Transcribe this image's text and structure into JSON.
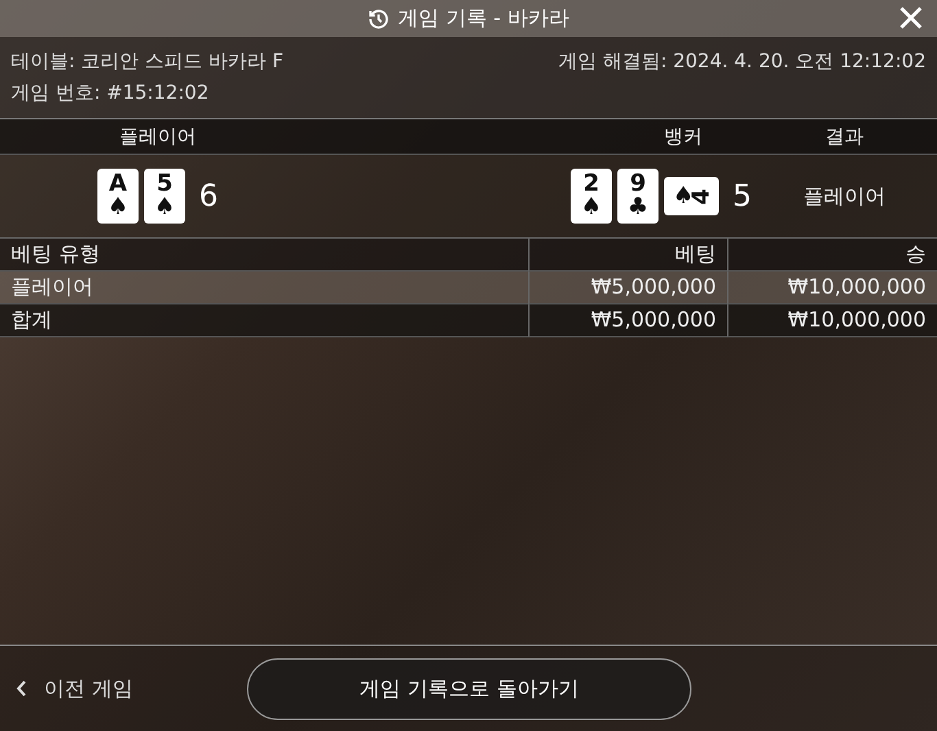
{
  "window": {
    "title": "게임 기록 - 바카라"
  },
  "info": {
    "table": "테이블: 코리안 스피드 바카라 F",
    "game_number": "게임 번호: #15:12:02",
    "resolved": "게임 해결됨: 2024. 4. 20. 오전 12:12:02"
  },
  "result_table": {
    "columns": [
      "플레이어",
      "뱅커",
      "결과"
    ],
    "player": {
      "cards": [
        {
          "rank": "A",
          "suit": "♠",
          "rotated": false
        },
        {
          "rank": "5",
          "suit": "♠",
          "rotated": false
        }
      ],
      "score": "6"
    },
    "banker": {
      "cards": [
        {
          "rank": "2",
          "suit": "♠",
          "rotated": false
        },
        {
          "rank": "9",
          "suit": "♣",
          "rotated": false
        },
        {
          "rank": "4",
          "suit": "♠",
          "rotated": true
        }
      ],
      "score": "5"
    },
    "result": "플레이어"
  },
  "bet_table": {
    "columns": [
      "베팅 유형",
      "베팅",
      "승"
    ],
    "rows": [
      {
        "kind": "bet",
        "cells": [
          "플레이어",
          "₩5,000,000",
          "₩10,000,000"
        ]
      },
      {
        "kind": "total",
        "cells": [
          "합계",
          "₩5,000,000",
          "₩10,000,000"
        ]
      }
    ]
  },
  "footer": {
    "previous": "이전 게임",
    "back_button": "게임 기록으로 돌아가기"
  }
}
